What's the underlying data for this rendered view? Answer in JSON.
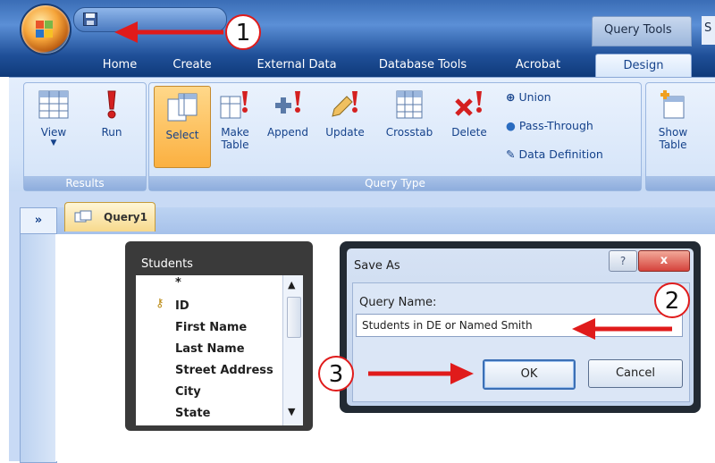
{
  "contextual_tab": {
    "label": "Query Tools",
    "overflow_letter": "S"
  },
  "tabs": [
    "Home",
    "Create",
    "External Data",
    "Database Tools",
    "Acrobat",
    "Design"
  ],
  "ribbon": {
    "results": {
      "label": "Results",
      "view": "View",
      "run": "Run"
    },
    "query_type": {
      "label": "Query Type",
      "select": "Select",
      "make_table": [
        "Make",
        "Table"
      ],
      "append": "Append",
      "update": "Update",
      "crosstab": "Crosstab",
      "delete": "Delete",
      "union": "Union",
      "pass_through": "Pass-Through",
      "data_definition": "Data Definition"
    },
    "show_table": [
      "Show",
      "Table"
    ]
  },
  "nav": {
    "toggle": "»"
  },
  "document_tab": {
    "label": "Query1"
  },
  "table": {
    "title": "Students",
    "fields": [
      "*",
      "ID",
      "First Name",
      "Last Name",
      "Street Address",
      "City",
      "State"
    ]
  },
  "dialog": {
    "title": "Save As",
    "help": "?",
    "close": "x",
    "field_label": "Query Name:",
    "field_value": "Students in DE or Named Smith",
    "ok": "OK",
    "cancel": "Cancel"
  },
  "callouts": [
    "1",
    "2",
    "3"
  ],
  "colors": {
    "callout": "#e01b1b",
    "ribbon_blue": "#15428b",
    "selected_orange": "#fbb040"
  }
}
